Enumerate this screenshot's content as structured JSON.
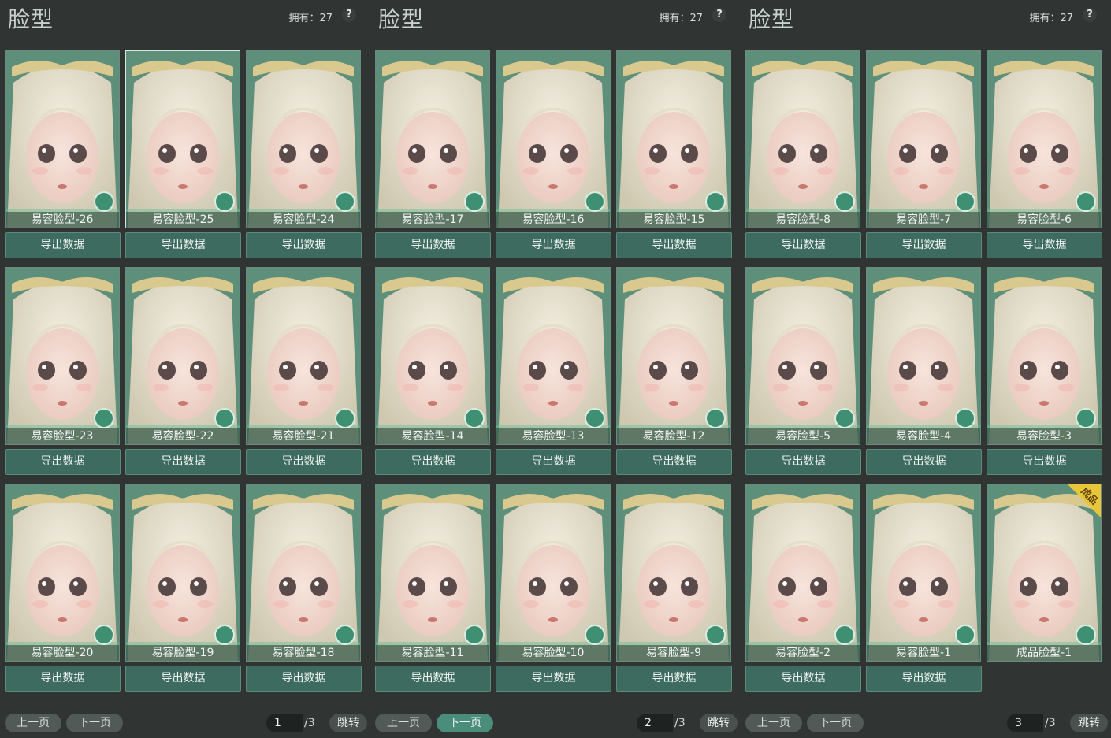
{
  "panels": [
    {
      "title": "脸型",
      "owned_text": "拥有：27",
      "help": "?",
      "cards": [
        {
          "label": "易容脸型-26",
          "selected": false,
          "badge": ""
        },
        {
          "label": "易容脸型-25",
          "selected": true,
          "badge": ""
        },
        {
          "label": "易容脸型-24",
          "selected": false,
          "badge": ""
        },
        {
          "label": "易容脸型-23",
          "selected": false,
          "badge": ""
        },
        {
          "label": "易容脸型-22",
          "selected": false,
          "badge": ""
        },
        {
          "label": "易容脸型-21",
          "selected": false,
          "badge": ""
        },
        {
          "label": "易容脸型-20",
          "selected": false,
          "badge": ""
        },
        {
          "label": "易容脸型-19",
          "selected": false,
          "badge": ""
        },
        {
          "label": "易容脸型-18",
          "selected": false,
          "badge": ""
        }
      ],
      "export_label": "导出数据",
      "pager": {
        "prev": "上一页",
        "next": "下一页",
        "current": "1",
        "total": "/3",
        "jump": "跳转",
        "active": "none"
      }
    },
    {
      "title": "脸型",
      "owned_text": "拥有：27",
      "help": "?",
      "cards": [
        {
          "label": "易容脸型-17",
          "selected": false,
          "badge": ""
        },
        {
          "label": "易容脸型-16",
          "selected": false,
          "badge": ""
        },
        {
          "label": "易容脸型-15",
          "selected": false,
          "badge": ""
        },
        {
          "label": "易容脸型-14",
          "selected": false,
          "badge": ""
        },
        {
          "label": "易容脸型-13",
          "selected": false,
          "badge": ""
        },
        {
          "label": "易容脸型-12",
          "selected": false,
          "badge": ""
        },
        {
          "label": "易容脸型-11",
          "selected": false,
          "badge": ""
        },
        {
          "label": "易容脸型-10",
          "selected": false,
          "badge": ""
        },
        {
          "label": "易容脸型-9",
          "selected": false,
          "badge": ""
        }
      ],
      "export_label": "导出数据",
      "pager": {
        "prev": "上一页",
        "next": "下一页",
        "current": "2",
        "total": "/3",
        "jump": "跳转",
        "active": "next"
      }
    },
    {
      "title": "脸型",
      "owned_text": "拥有：27",
      "help": "?",
      "cards": [
        {
          "label": "易容脸型-8",
          "selected": false,
          "badge": ""
        },
        {
          "label": "易容脸型-7",
          "selected": false,
          "badge": ""
        },
        {
          "label": "易容脸型-6",
          "selected": false,
          "badge": ""
        },
        {
          "label": "易容脸型-5",
          "selected": false,
          "badge": ""
        },
        {
          "label": "易容脸型-4",
          "selected": false,
          "badge": ""
        },
        {
          "label": "易容脸型-3",
          "selected": false,
          "badge": ""
        },
        {
          "label": "易容脸型-2",
          "selected": false,
          "badge": ""
        },
        {
          "label": "易容脸型-1",
          "selected": false,
          "badge": ""
        },
        {
          "label": "成品脸型-1",
          "selected": false,
          "badge": "成品",
          "no_export": true
        }
      ],
      "export_label": "导出数据",
      "pager": {
        "prev": "上一页",
        "next": "下一页",
        "current": "3",
        "total": "/3",
        "jump": "跳转",
        "active": "none"
      }
    }
  ],
  "colors": {
    "accent": "#4a8d7a",
    "card_bg": "#5a8a78",
    "button_bg": "#3d6b5f",
    "badge": "#e9c53a"
  },
  "icons": {
    "help": "help-icon",
    "brush": "brush-icon"
  }
}
